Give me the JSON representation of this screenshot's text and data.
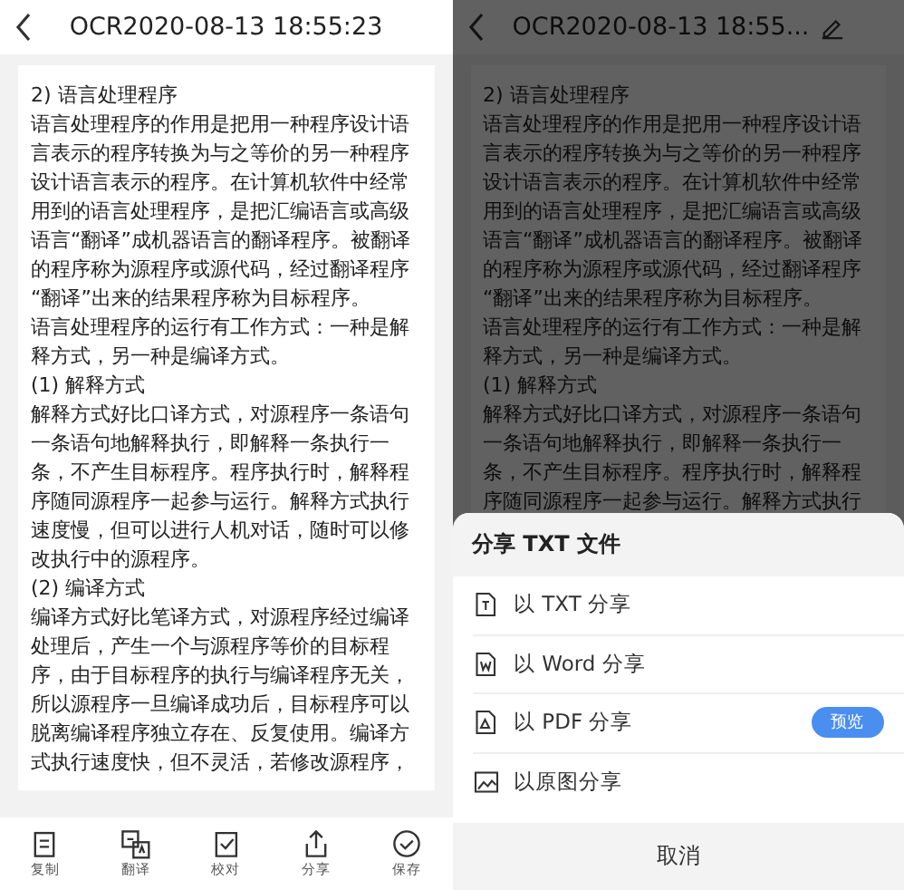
{
  "left_screen": {
    "title": "OCR2020-08-13 18:55:23",
    "document": {
      "lines": [
        "2) 语言处理程序",
        "语言处理程序的作用是把用一种程序设计语",
        "言表示的程序转换为与之等价的另一种程序",
        "设计语言表示的程序。在计算机软件中经常",
        "用到的语言处理程序，是把汇编语言或高级",
        "语言“翻译”成机器语言的翻译程序。被翻译",
        "的程序称为源程序或源代码，经过翻译程序",
        "“翻译”出来的结果程序称为目标程序。",
        "语言处理程序的运行有工作方式：一种是解",
        "释方式，另一种是编译方式。",
        "(1) 解释方式",
        "解释方式好比口译方式，对源程序一条语句",
        "一条语句地解释执行，即解释一条执行一",
        "条，不产生目标程序。程序执行时，解释程",
        "序随同源程序一起参与运行。解释方式执行",
        "速度慢，但可以进行人机对话，随时可以修",
        "改执行中的源程序。",
        "(2) 编译方式",
        "编译方式好比笔译方式，对源程序经过编译",
        "处理后，产生一个与源程序等价的目标程",
        "序，由于目标程序的执行与编译程序无关，",
        "所以源程序一旦编译成功后，目标程序可以",
        "脱离编译程序独立存在、反复使用。编译方",
        "式执行速度快，但不灵活，若修改源程序，"
      ]
    },
    "toolbar": [
      {
        "label": "复制"
      },
      {
        "label": "翻译"
      },
      {
        "label": "校对"
      },
      {
        "label": "分享"
      },
      {
        "label": "保存"
      }
    ]
  },
  "right_screen": {
    "title": "OCR2020-08-13 18:55...",
    "document": {
      "lines": [
        "2) 语言处理程序",
        "语言处理程序的作用是把用一种程序设计语",
        "言表示的程序转换为与之等价的另一种程序",
        "设计语言表示的程序。在计算机软件中经常",
        "用到的语言处理程序，是把汇编语言或高级",
        "语言“翻译”成机器语言的翻译程序。被翻译",
        "的程序称为源程序或源代码，经过翻译程序",
        "“翻译”出来的结果程序称为目标程序。",
        "语言处理程序的运行有工作方式：一种是解",
        "释方式，另一种是编译方式。",
        "(1) 解释方式",
        "解释方式好比口译方式，对源程序一条语句",
        "一条语句地解释执行，即解释一条执行一",
        "条，不产生目标程序。程序执行时，解释程",
        "序随同源程序一起参与运行。解释方式执行"
      ]
    },
    "share_sheet": {
      "title": "分享 TXT 文件",
      "options": [
        {
          "label": "以 TXT 分享"
        },
        {
          "label": "以 Word 分享"
        },
        {
          "label": "以 PDF 分享",
          "button": "预览"
        },
        {
          "label": "以原图分享"
        }
      ],
      "cancel": "取消"
    }
  }
}
